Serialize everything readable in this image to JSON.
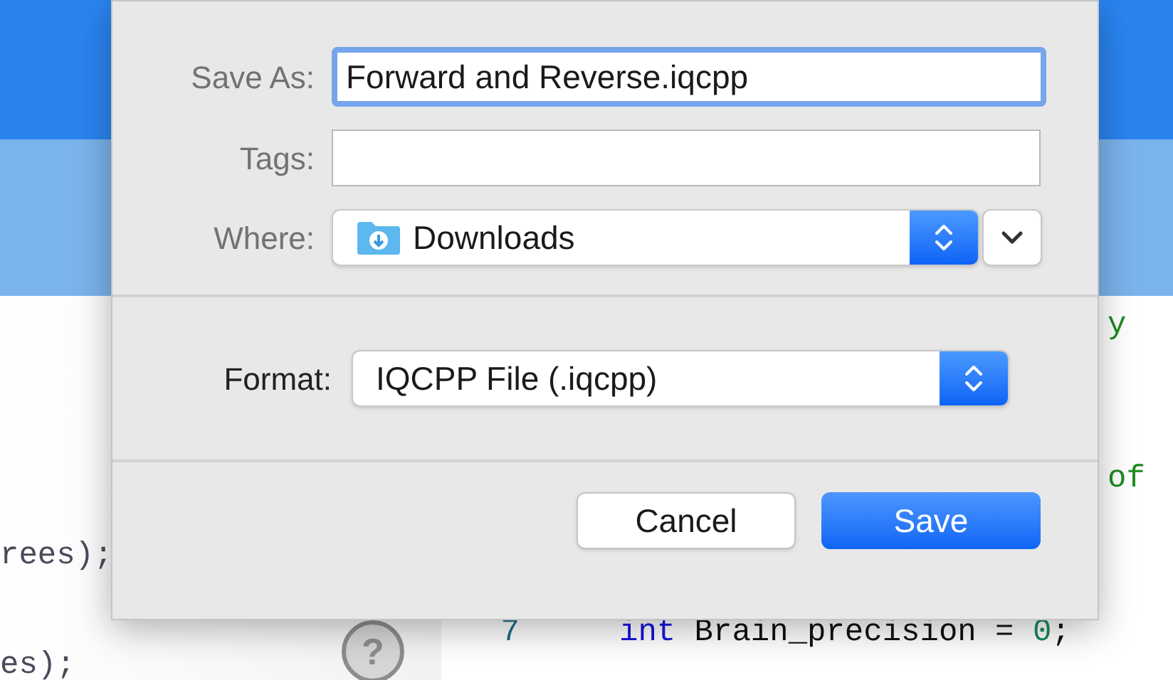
{
  "dialog": {
    "save_as": {
      "label": "Save As:",
      "value": "Forward and Reverse.iqcpp",
      "focused": true
    },
    "tags": {
      "label": "Tags:"
    },
    "where": {
      "label": "Where:",
      "value": "Downloads"
    },
    "format": {
      "label": "Format:",
      "value": "IQCPP File (.iqcpp)"
    },
    "buttons": [
      {
        "label": "Cancel",
        "kind": "secondary"
      },
      {
        "label": "Save",
        "kind": "primary"
      }
    ]
  },
  "background": {
    "left_lines": [
      "rees);",
      "es);"
    ],
    "help": "?",
    "comments": [
      "y",
      "of"
    ],
    "code_lines": [
      {
        "number": "7",
        "keyword": "int",
        "text": "Brain_precision = ",
        "literal": "0",
        "end": ";"
      }
    ]
  }
}
